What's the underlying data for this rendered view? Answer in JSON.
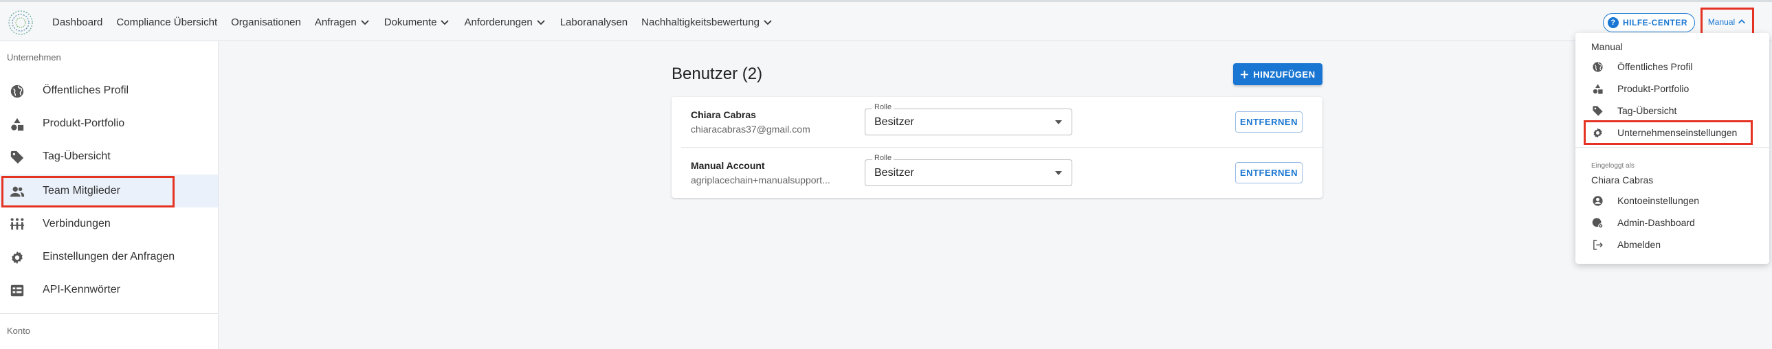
{
  "nav": {
    "items": [
      {
        "label": "Dashboard",
        "dropdown": false
      },
      {
        "label": "Compliance Übersicht",
        "dropdown": false
      },
      {
        "label": "Organisationen",
        "dropdown": false
      },
      {
        "label": "Anfragen",
        "dropdown": true
      },
      {
        "label": "Dokumente",
        "dropdown": true
      },
      {
        "label": "Anforderungen",
        "dropdown": true
      },
      {
        "label": "Laboranalysen",
        "dropdown": false
      },
      {
        "label": "Nachhaltigkeitsbewertung",
        "dropdown": true
      }
    ],
    "help_label": "HILFE-CENTER",
    "account_label": "Manual"
  },
  "sidebar": {
    "section_company": "Unternehmen",
    "items": [
      {
        "label": "Öffentliches Profil",
        "icon": "globe-icon"
      },
      {
        "label": "Produkt-Portfolio",
        "icon": "shapes-icon"
      },
      {
        "label": "Tag-Übersicht",
        "icon": "tag-icon"
      },
      {
        "label": "Team Mitglieder",
        "icon": "people-icon"
      },
      {
        "label": "Verbindungen",
        "icon": "connections-icon"
      },
      {
        "label": "Einstellungen der Anfragen",
        "icon": "gear-icon"
      },
      {
        "label": "API-Kennwörter",
        "icon": "api-icon"
      }
    ],
    "active_index": 3,
    "section_account": "Konto"
  },
  "main": {
    "title": "Benutzer (2)",
    "add_label": "HINZUFÜGEN",
    "users": [
      {
        "name": "Chiara Cabras",
        "email": "chiaracabras37@gmail.com",
        "role_label": "Rolle",
        "role": "Besitzer",
        "remove_label": "ENTFERNEN"
      },
      {
        "name": "Manual Account",
        "email": "agriplacechain+manualsupport...",
        "role_label": "Rolle",
        "role": "Besitzer",
        "remove_label": "ENTFERNEN"
      }
    ]
  },
  "dropdown": {
    "title": "Manual",
    "items": [
      {
        "label": "Öffentliches Profil",
        "icon": "globe-icon"
      },
      {
        "label": "Produkt-Portfolio",
        "icon": "shapes-icon"
      },
      {
        "label": "Tag-Übersicht",
        "icon": "tag-icon"
      },
      {
        "label": "Unternehmenseinstellungen",
        "icon": "gear-icon"
      }
    ],
    "logged_in_as": "Eingeloggt als",
    "user_name": "Chiara Cabras",
    "account_items": [
      {
        "label": "Kontoeinstellungen",
        "icon": "account-circle-icon"
      },
      {
        "label": "Admin-Dashboard",
        "icon": "admin-icon"
      },
      {
        "label": "Abmelden",
        "icon": "logout-icon"
      }
    ]
  },
  "colors": {
    "accent": "#1976d2",
    "highlight": "#e53323",
    "active_bg": "#eaf1fb"
  }
}
